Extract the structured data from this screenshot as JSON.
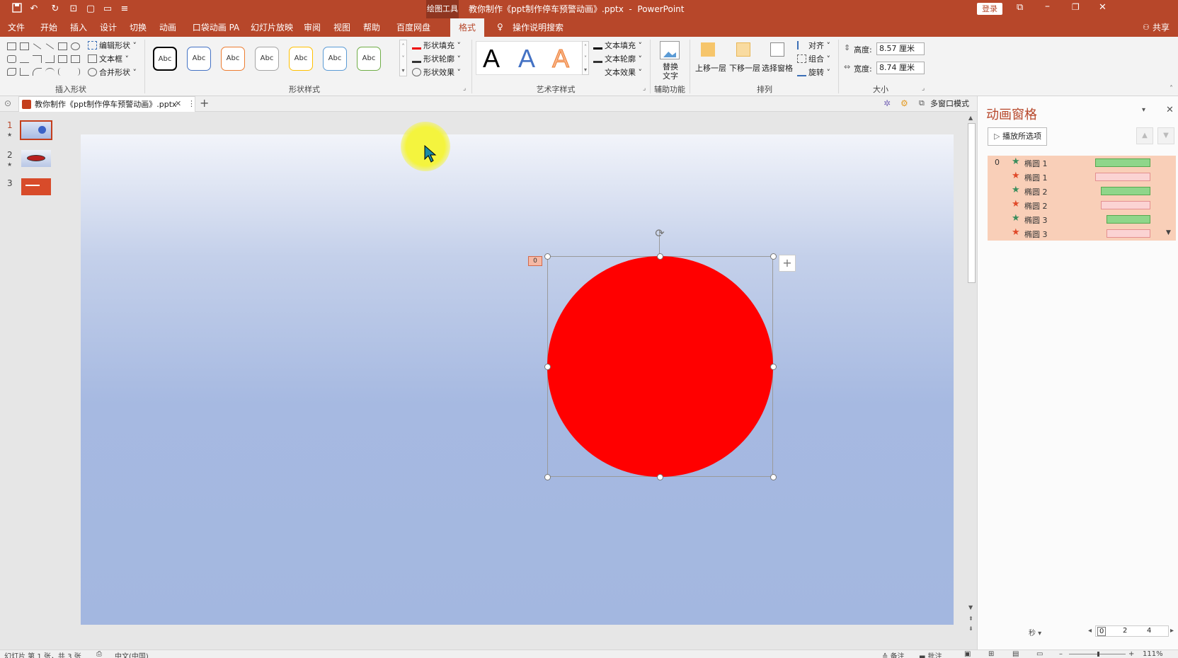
{
  "titlebar": {
    "context_tool": "绘图工具",
    "document_title": "教你制作《ppt制作停车预警动画》.pptx  -  PowerPoint",
    "login_label": "登录"
  },
  "tabs": [
    {
      "label": "文件"
    },
    {
      "label": "开始"
    },
    {
      "label": "插入"
    },
    {
      "label": "设计"
    },
    {
      "label": "切换"
    },
    {
      "label": "动画"
    },
    {
      "label": "口袋动画 PA"
    },
    {
      "label": "幻灯片放映"
    },
    {
      "label": "审阅"
    },
    {
      "label": "视图"
    },
    {
      "label": "帮助"
    },
    {
      "label": "百度网盘"
    },
    {
      "label": "格式"
    }
  ],
  "tell_me": "操作说明搜索",
  "share": "共享",
  "ribbon": {
    "insert_shapes": {
      "label": "插入形状",
      "edit_shape": "编辑形状",
      "text_box": "文本框",
      "merge_shapes": "合并形状"
    },
    "shape_styles": {
      "label": "形状样式",
      "swatch_text": "Abc",
      "swatch_colors": [
        "#000000",
        "#4472c4",
        "#ed7d31",
        "#a5a5a5",
        "#ffc000",
        "#5b9bd5",
        "#70ad47"
      ],
      "fill": "形状填充",
      "outline": "形状轮廓",
      "effects": "形状效果"
    },
    "wordart": {
      "label": "艺术字样式",
      "letter": "A",
      "fill": "文本填充",
      "outline": "文本轮廓",
      "effects": "文本效果"
    },
    "accessibility": {
      "label": "辅助功能",
      "alt_text_line1": "替换",
      "alt_text_line2": "文字"
    },
    "arrange": {
      "label": "排列",
      "bring_forward": "上移一层",
      "send_backward": "下移一层",
      "selection_pane": "选择窗格",
      "align": "对齐",
      "group": "组合",
      "rotate": "旋转"
    },
    "size": {
      "label": "大小",
      "height_label": "高度:",
      "height_value": "8.57 厘米",
      "width_label": "宽度:",
      "width_value": "8.74 厘米"
    }
  },
  "doc_tab": {
    "filename": "教你制作《ppt制作停车预警动画》.pptx",
    "multi_window": "多窗口模式"
  },
  "thumbnails": [
    {
      "number": "1",
      "star": "★"
    },
    {
      "number": "2",
      "star": "★"
    },
    {
      "number": "3",
      "star": ""
    }
  ],
  "slide": {
    "circle_color": "#ff0000",
    "anim_tag": "0"
  },
  "animation_pane": {
    "title": "动画窗格",
    "play_button": "播放所选项",
    "rows": [
      {
        "index": "0",
        "name": "椭圆 1",
        "effect": "entrance"
      },
      {
        "index": "",
        "name": "椭圆 1",
        "effect": "exit"
      },
      {
        "index": "",
        "name": "椭圆 2",
        "effect": "entrance"
      },
      {
        "index": "",
        "name": "椭圆 2",
        "effect": "exit"
      },
      {
        "index": "",
        "name": "椭圆 3",
        "effect": "entrance"
      },
      {
        "index": "",
        "name": "椭圆 3",
        "effect": "exit"
      }
    ],
    "seconds_label": "秒",
    "timeline_ticks": [
      "0",
      "2",
      "4"
    ]
  },
  "statusbar": {
    "slide_info": "幻灯片 第 1 张，共 3 张",
    "language": "中文(中国)",
    "notes": "备注",
    "comments": "批注",
    "zoom": "111%"
  }
}
